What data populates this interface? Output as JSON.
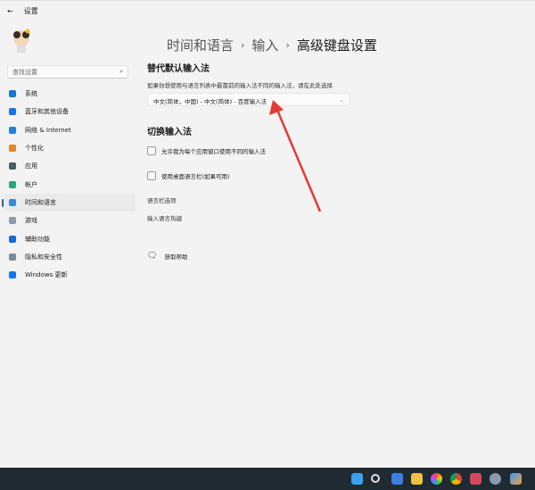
{
  "window": {
    "back_icon": "back-arrow-icon",
    "title": "设置"
  },
  "search": {
    "placeholder": "查找设置",
    "icon": "search-icon"
  },
  "sidebar": {
    "items": [
      {
        "label": "系统",
        "icon": "monitor-icon",
        "color": "#1877d2"
      },
      {
        "label": "蓝牙和其他设备",
        "icon": "bluetooth-icon",
        "color": "#1a73e8"
      },
      {
        "label": "网络 & Internet",
        "icon": "wifi-icon",
        "color": "#2a7fd4"
      },
      {
        "label": "个性化",
        "icon": "brush-icon",
        "color": "#d88a2a"
      },
      {
        "label": "应用",
        "icon": "apps-icon",
        "color": "#4a5a6a"
      },
      {
        "label": "帐户",
        "icon": "person-icon",
        "color": "#2aa47a"
      },
      {
        "label": "时间和语言",
        "icon": "globe-clock-icon",
        "color": "#3a8ad0",
        "active": true
      },
      {
        "label": "游戏",
        "icon": "gamepad-icon",
        "color": "#8a9aa8"
      },
      {
        "label": "辅助功能",
        "icon": "accessibility-icon",
        "color": "#1a6ad0"
      },
      {
        "label": "隐私和安全性",
        "icon": "shield-icon",
        "color": "#7a8a98"
      },
      {
        "label": "Windows 更新",
        "icon": "update-icon",
        "color": "#1a73e8"
      }
    ]
  },
  "breadcrumb": {
    "items": [
      "时间和语言",
      "输入",
      "高级键盘设置"
    ],
    "separator": "›"
  },
  "section1": {
    "title": "替代默认输入法",
    "description": "如果你想使用与语言列表中最靠前的输入法不同的输入法，请在此处选择",
    "dropdown_value": "中文(简体，中国) - 中文(简体) - 百度输入法"
  },
  "section2": {
    "title": "切换输入法",
    "checkboxes": [
      {
        "label": "允许我为每个应用窗口使用不同的输入法",
        "checked": false
      },
      {
        "label": "使用桌面语言栏(如果可用)",
        "checked": false
      }
    ],
    "links": [
      "语言栏选项",
      "输入语言热键"
    ]
  },
  "help": {
    "label": "获取帮助",
    "icon": "help-icon"
  },
  "annotation": {
    "color": "#e53935"
  },
  "taskbar": {
    "icons": [
      "windows-start-icon",
      "search-icon",
      "widgets-icon",
      "file-explorer-icon",
      "colorful-app-icon",
      "chrome-icon",
      "app-icon",
      "settings-icon",
      "paint-icon"
    ]
  }
}
